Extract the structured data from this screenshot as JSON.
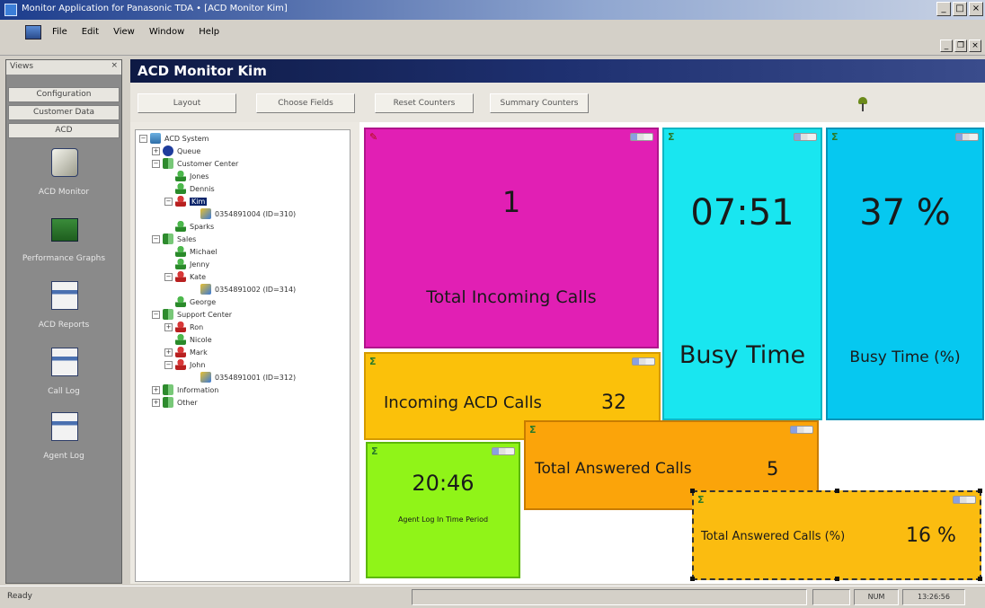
{
  "window": {
    "title": "Monitor Application for Panasonic TDA • [ACD Monitor Kim]"
  },
  "menu": {
    "items": [
      "File",
      "Edit",
      "View",
      "Window",
      "Help"
    ]
  },
  "views": {
    "header": "Views",
    "buttons": [
      "Configuration",
      "Customer Data",
      "ACD"
    ],
    "nav": [
      "ACD Monitor",
      "Performance Graphs",
      "ACD Reports",
      "Call Log",
      "Agent Log"
    ]
  },
  "monitor": {
    "title": "ACD Monitor Kim",
    "toolbar": [
      "Layout",
      "Choose Fields",
      "Reset Counters",
      "Summary Counters"
    ]
  },
  "tree": {
    "nodes": [
      "ACD System",
      "Queue",
      "Customer Center",
      "Jones",
      "Dennis",
      "Kim",
      "0354891004 (ID=310)",
      "Sparks",
      "Sales",
      "Michael",
      "Jenny",
      "Kate",
      "0354891002 (ID=314)",
      "George",
      "Support Center",
      "Ron",
      "Nicole",
      "Mark",
      "John",
      "0354891001 (ID=312)",
      "Information",
      "Other"
    ]
  },
  "widgets": {
    "total_incoming": {
      "value": "1",
      "label": "Total Incoming Calls",
      "color": "#e11fb4"
    },
    "busy_time": {
      "value": "07:51",
      "label": "Busy Time",
      "color": "#19e6f0"
    },
    "busy_time_pct": {
      "value": "37 %",
      "label": "Busy Time (%)",
      "color": "#06c8f0"
    },
    "incoming_acd": {
      "label": "Incoming ACD Calls",
      "value": "32",
      "color": "#fbc10a"
    },
    "total_answered": {
      "label": "Total Answered Calls",
      "value": "5",
      "color": "#fba40a"
    },
    "agent_login": {
      "value": "20:46",
      "label": "Agent Log In Time Period",
      "color": "#90f418"
    },
    "answered_pct": {
      "label": "Total Answered Calls (%)",
      "value": "16 %",
      "color": "#fbbc10"
    }
  },
  "status": {
    "ready": "Ready",
    "num": "NUM",
    "time": "13:26:56"
  }
}
